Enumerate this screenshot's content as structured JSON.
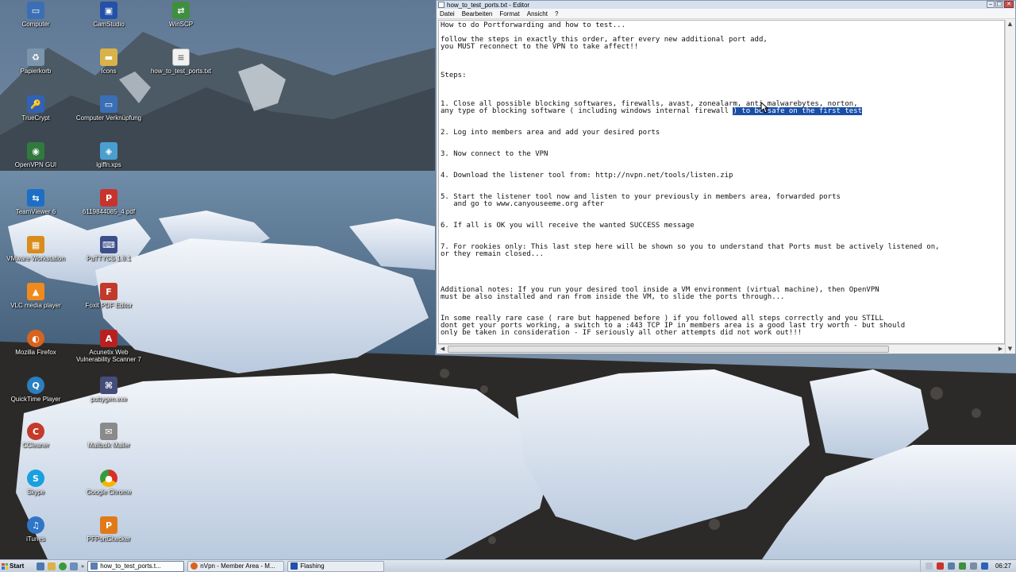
{
  "desktop": {
    "icons": [
      {
        "label": "Computer",
        "icon": "computer-icon",
        "color": "#3b6fb5"
      },
      {
        "label": "CamStudio",
        "icon": "camstudio-icon",
        "color": "#2350a8"
      },
      {
        "label": "WinSCP",
        "icon": "winscp-icon",
        "color": "#3f8f3f"
      },
      {
        "label": "Papierkorb",
        "icon": "recycle-bin-icon",
        "color": "#7c95ad"
      },
      {
        "label": "Icons",
        "icon": "folder-icon",
        "color": "#d9b24a"
      },
      {
        "label": "how_to_test_ports.txt",
        "icon": "text-file-icon",
        "color": "#f2f2f2"
      },
      {
        "label": "TrueCrypt",
        "icon": "truecrypt-icon",
        "color": "#2f62b8"
      },
      {
        "label": "Computer Verknüpfung",
        "icon": "computer-shortcut-icon",
        "color": "#3b6fb5"
      },
      {
        "label": "OpenVPN GUI",
        "icon": "openvpn-icon",
        "color": "#2f7a3d"
      },
      {
        "label": "lgiffn.xps",
        "icon": "xps-file-icon",
        "color": "#4a9fd0"
      },
      {
        "label": "TeamViewer 6",
        "icon": "teamviewer-icon",
        "color": "#1d6fc5"
      },
      {
        "label": "6119844085_4.pdf",
        "icon": "pdf-file-icon",
        "color": "#c8342c"
      },
      {
        "label": "VMware Workstation",
        "icon": "vmware-icon",
        "color": "#d98b1c"
      },
      {
        "label": "PuTTYCS 1.8.1",
        "icon": "putty-icon",
        "color": "#3c4f8a"
      },
      {
        "label": "VLC media player",
        "icon": "vlc-icon",
        "color": "#f08a1c"
      },
      {
        "label": "Foxit PDF Editor",
        "icon": "foxit-icon",
        "color": "#c23a2a"
      },
      {
        "label": "Mozilla Firefox",
        "icon": "firefox-icon",
        "color": "#d8631e"
      },
      {
        "label": "Acunetix Web Vulnerability Scanner 7",
        "icon": "acunetix-icon",
        "color": "#b82020"
      },
      {
        "label": "QuickTime Player",
        "icon": "quicktime-icon",
        "color": "#2a7fc0"
      },
      {
        "label": "puttygen.exe",
        "icon": "puttygen-icon",
        "color": "#444c7a"
      },
      {
        "label": "CCleaner",
        "icon": "ccleaner-icon",
        "color": "#c43b2b"
      },
      {
        "label": "Mailbulk Mailer",
        "icon": "mailer-icon",
        "color": "#8a8a8a"
      },
      {
        "label": "Skype",
        "icon": "skype-icon",
        "color": "#18a0e0"
      },
      {
        "label": "Google Chrome",
        "icon": "chrome-icon",
        "color": "#3a9a3a"
      },
      {
        "label": "iTunes",
        "icon": "itunes-icon",
        "color": "#2f76c8"
      },
      {
        "label": "PFPortChecker",
        "icon": "portchecker-icon",
        "color": "#e07a18"
      }
    ]
  },
  "editor": {
    "title": "how_to_test_ports.txt - Editor",
    "menu": [
      "Datei",
      "Bearbeiten",
      "Format",
      "Ansicht",
      "?"
    ],
    "lines": [
      "How to do Portforwarding and how to test...",
      "",
      "follow the steps in exactly this order, after every new additional port add,",
      "you MUST reconnect to the VPN to take affect!!",
      "",
      "",
      "",
      "Steps:",
      "",
      "",
      "",
      "1. Close all possible blocking softwares, firewalls, avast, zonealarm, anti malwarebytes, norton,",
      "any type of blocking software ( including windows internal firewall ) to be safe on the first test",
      "",
      "",
      "2. Log into members area and add your desired ports",
      "",
      "",
      "3. Now connect to the VPN",
      "",
      "",
      "4. Download the listener tool from: http://nvpn.net/tools/listen.zip",
      "",
      "",
      "5. Start the listener tool now and listen to your previously in members area, forwarded ports",
      "   and go to www.canyouseeme.org after",
      "",
      "",
      "6. If all is OK you will receive the wanted SUCCESS message",
      "",
      "",
      "7. For rookies only: This last step here will be shown so you to understand that Ports must be actively listened on,",
      "or they remain closed...",
      "",
      "",
      "",
      "",
      "Additional notes: If you run your desired tool inside a VM environment (virtual machine), then OpenVPN",
      "must be also installed and ran from inside the VM, to slide the ports through...",
      "",
      "",
      "In some really rare case ( rare but happened before ) if you followed all steps correctly and you STILL",
      "dont get your ports working, a switch to a :443 TCP IP in members area is a good last try worth - but should",
      "only be taken in consideration - IF seriously all other attempts did not work out!!!"
    ],
    "selected_line_index": 12,
    "selected_from": ") to be safe on the first test",
    "colors": {
      "selection": "#1a4fa8"
    }
  },
  "taskbar": {
    "start_label": "Start",
    "tasks": [
      {
        "label": "how_to_test_ports.t...",
        "active": true,
        "icon": "notepad-icon",
        "color": "#5b7fb0"
      },
      {
        "label": "nVpn - Member Area - M...",
        "active": false,
        "icon": "firefox-icon",
        "color": "#d8631e"
      },
      {
        "label": "Flashing",
        "active": false,
        "icon": "camstudio-icon",
        "color": "#2350a8"
      }
    ],
    "clock": "06:27"
  }
}
